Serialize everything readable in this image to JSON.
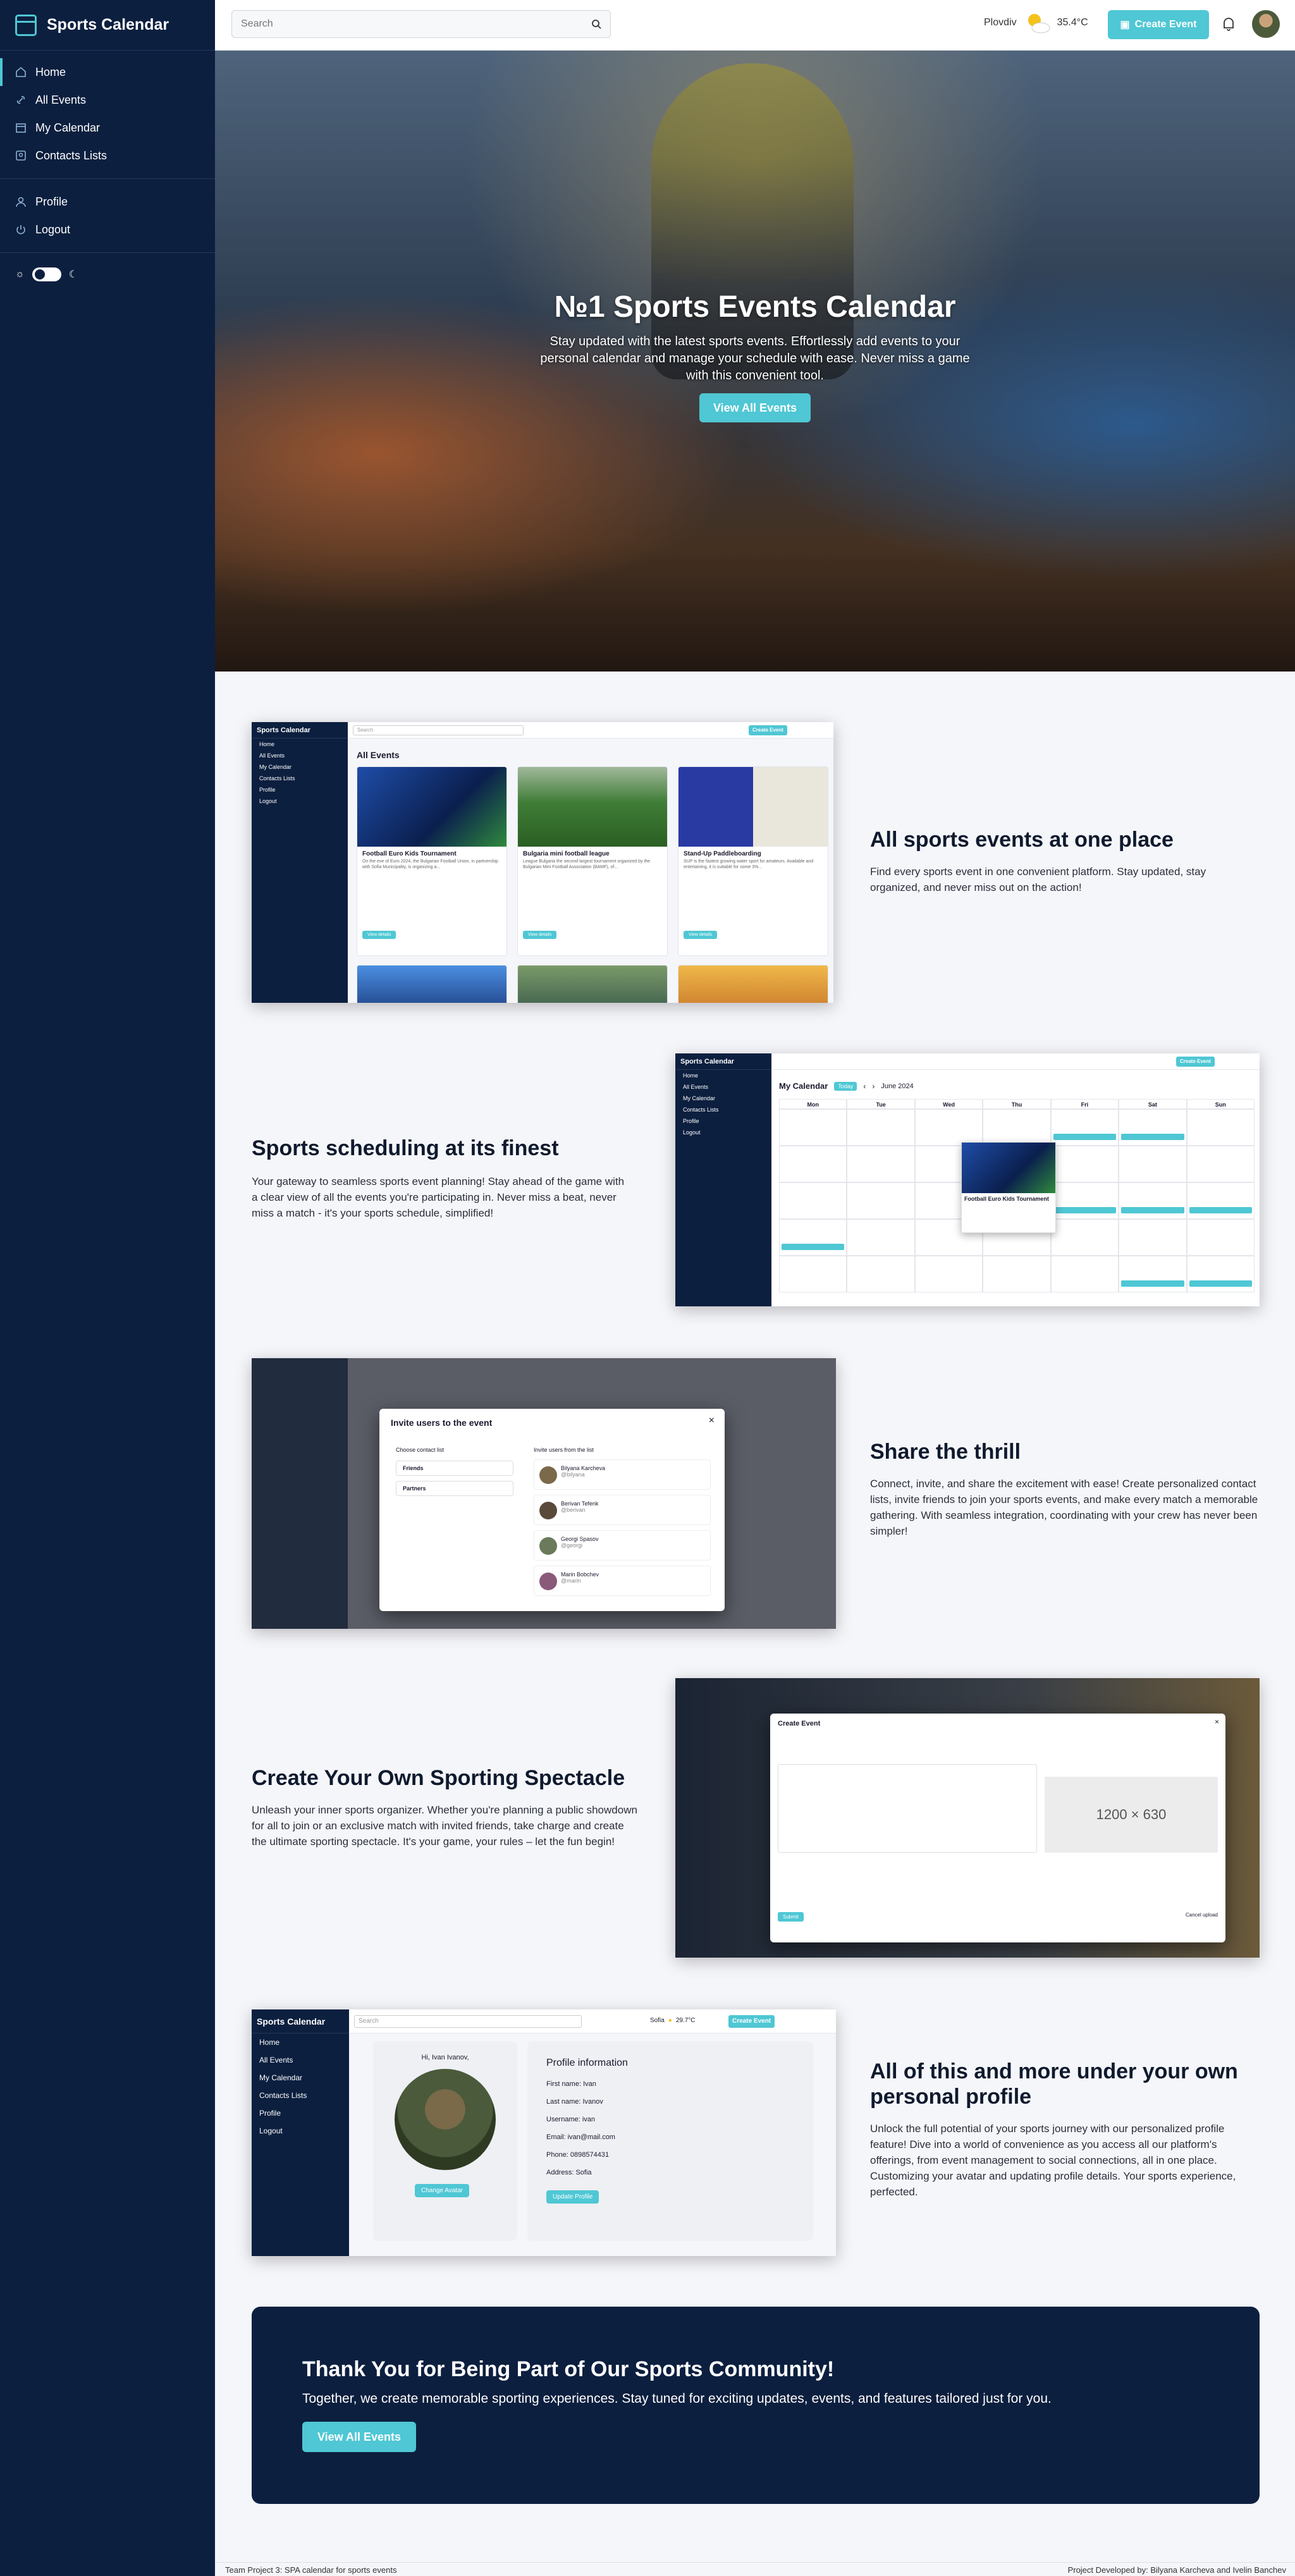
{
  "app": {
    "title": "Sports Calendar"
  },
  "sidebar": {
    "items": [
      {
        "label": "Home",
        "icon": "home-icon"
      },
      {
        "label": "All Events",
        "icon": "link-icon"
      },
      {
        "label": "My Calendar",
        "icon": "calendar-icon"
      },
      {
        "label": "Contacts Lists",
        "icon": "contacts-icon"
      }
    ],
    "account": [
      {
        "label": "Profile",
        "icon": "user-icon"
      },
      {
        "label": "Logout",
        "icon": "power-icon"
      }
    ]
  },
  "topbar": {
    "search_placeholder": "Search",
    "city": "Plovdiv",
    "temp": "35.4°C",
    "create_label": "Create Event"
  },
  "hero": {
    "title": "№1 Sports Events Calendar",
    "subtitle": "Stay updated with the latest sports events. Effortlessly add events to your personal calendar and manage your schedule with ease. Never miss a game with this convenient tool.",
    "button": "View All Events"
  },
  "features": [
    {
      "title": "All sports events at one place",
      "desc": "Find every sports event in one convenient platform. Stay updated, stay organized, and never miss out on the action!"
    },
    {
      "title": "Sports scheduling at its finest",
      "desc": "Your gateway to seamless sports event planning! Stay ahead of the game with a clear view of all the events you're participating in. Never miss a beat, never miss a match - it's your sports schedule, simplified!"
    },
    {
      "title": "Share the thrill",
      "desc": "Connect, invite, and share the excitement with ease! Create personalized contact lists, invite friends to join your sports events, and make every match a memorable gathering. With seamless integration, coordinating with your crew has never been simpler!"
    },
    {
      "title": "Create Your Own Sporting Spectacle",
      "desc": "Unleash your inner sports organizer. Whether you're planning a public showdown for all to join or an exclusive match with invited friends, take charge and create the ultimate sporting spectacle. It's your game, your rules – let the fun begin!"
    },
    {
      "title": "All of this and more under your own personal profile",
      "desc": "Unlock the full potential of your sports journey with our personalized profile feature! Dive into a world of convenience as you access all our platform's offerings, from event management to social connections, all in one place. Customizing your avatar and updating profile details. Your sports experience, perfected."
    }
  ],
  "shot1": {
    "heading": "All Events",
    "cards": [
      {
        "title": "Football Euro Kids Tournament",
        "desc": "On the eve of Euro 2024, the Bulgarian Football Union, in partnership with Sofia Municipality, is organizing a...",
        "btn": "View details"
      },
      {
        "title": "Bulgaria mini football league",
        "desc": "League Bulgaria the second largest tournament organized by the Bulgarian Mini Football Association (BAMF), of...",
        "btn": "View details"
      },
      {
        "title": "Stand-Up Paddleboarding",
        "desc": "SUP is the fastest growing water sport for amateurs. Available and entertaining, it is suitable for some 3%...",
        "btn": "View details"
      }
    ]
  },
  "shot2": {
    "heading": "My Calendar",
    "month": "June 2024",
    "today": "Today",
    "days": [
      "Mon",
      "Tue",
      "Wed",
      "Thu",
      "Fri",
      "Sat",
      "Sun"
    ],
    "popup_title": "Football Euro Kids Tournament"
  },
  "shot3": {
    "modal_title": "Invite users to the event",
    "lists_label": "Choose contact list",
    "lists": [
      "Friends",
      "Partners"
    ],
    "users_label": "Invite users from the list",
    "users": [
      {
        "name": "Bilyana Karcheva",
        "handle": "@bilyana"
      },
      {
        "name": "Berivan Tefenk",
        "handle": "@berivan"
      },
      {
        "name": "Georgi Spasov",
        "handle": "@georgi"
      },
      {
        "name": "Marin Bobchev",
        "handle": "@marin"
      }
    ]
  },
  "shot4": {
    "modal_title": "Create Event",
    "image_placeholder": "1200 × 630",
    "submit": "Submit",
    "cancel": "Cancel upload"
  },
  "shot5": {
    "greeting": "Hi, Ivan Ivanov,",
    "change_avatar": "Change Avatar",
    "info_title": "Profile information",
    "fields": [
      "First name: Ivan",
      "Last name: Ivanov",
      "Username: ivan",
      "Email: ivan@mail.com",
      "Phone: 0898574431",
      "Address: Sofia"
    ],
    "update": "Update Profile",
    "city": "Sofia",
    "temp": "29.7°C"
  },
  "cta": {
    "title": "Thank You for Being Part of Our Sports Community!",
    "subtitle": "Together, we create memorable sporting experiences. Stay tuned for exciting updates, events, and features tailored just for you.",
    "button": "View All Events"
  },
  "footer": {
    "left": "Team Project 3: SPA calendar for sports events",
    "right": "Project Developed by:  Bilyana Karcheva  and  Ivelin Banchev"
  },
  "colors": {
    "accent": "#4fc7d4",
    "navy": "#0c1f3f",
    "page_bg": "#f5f6fa"
  }
}
